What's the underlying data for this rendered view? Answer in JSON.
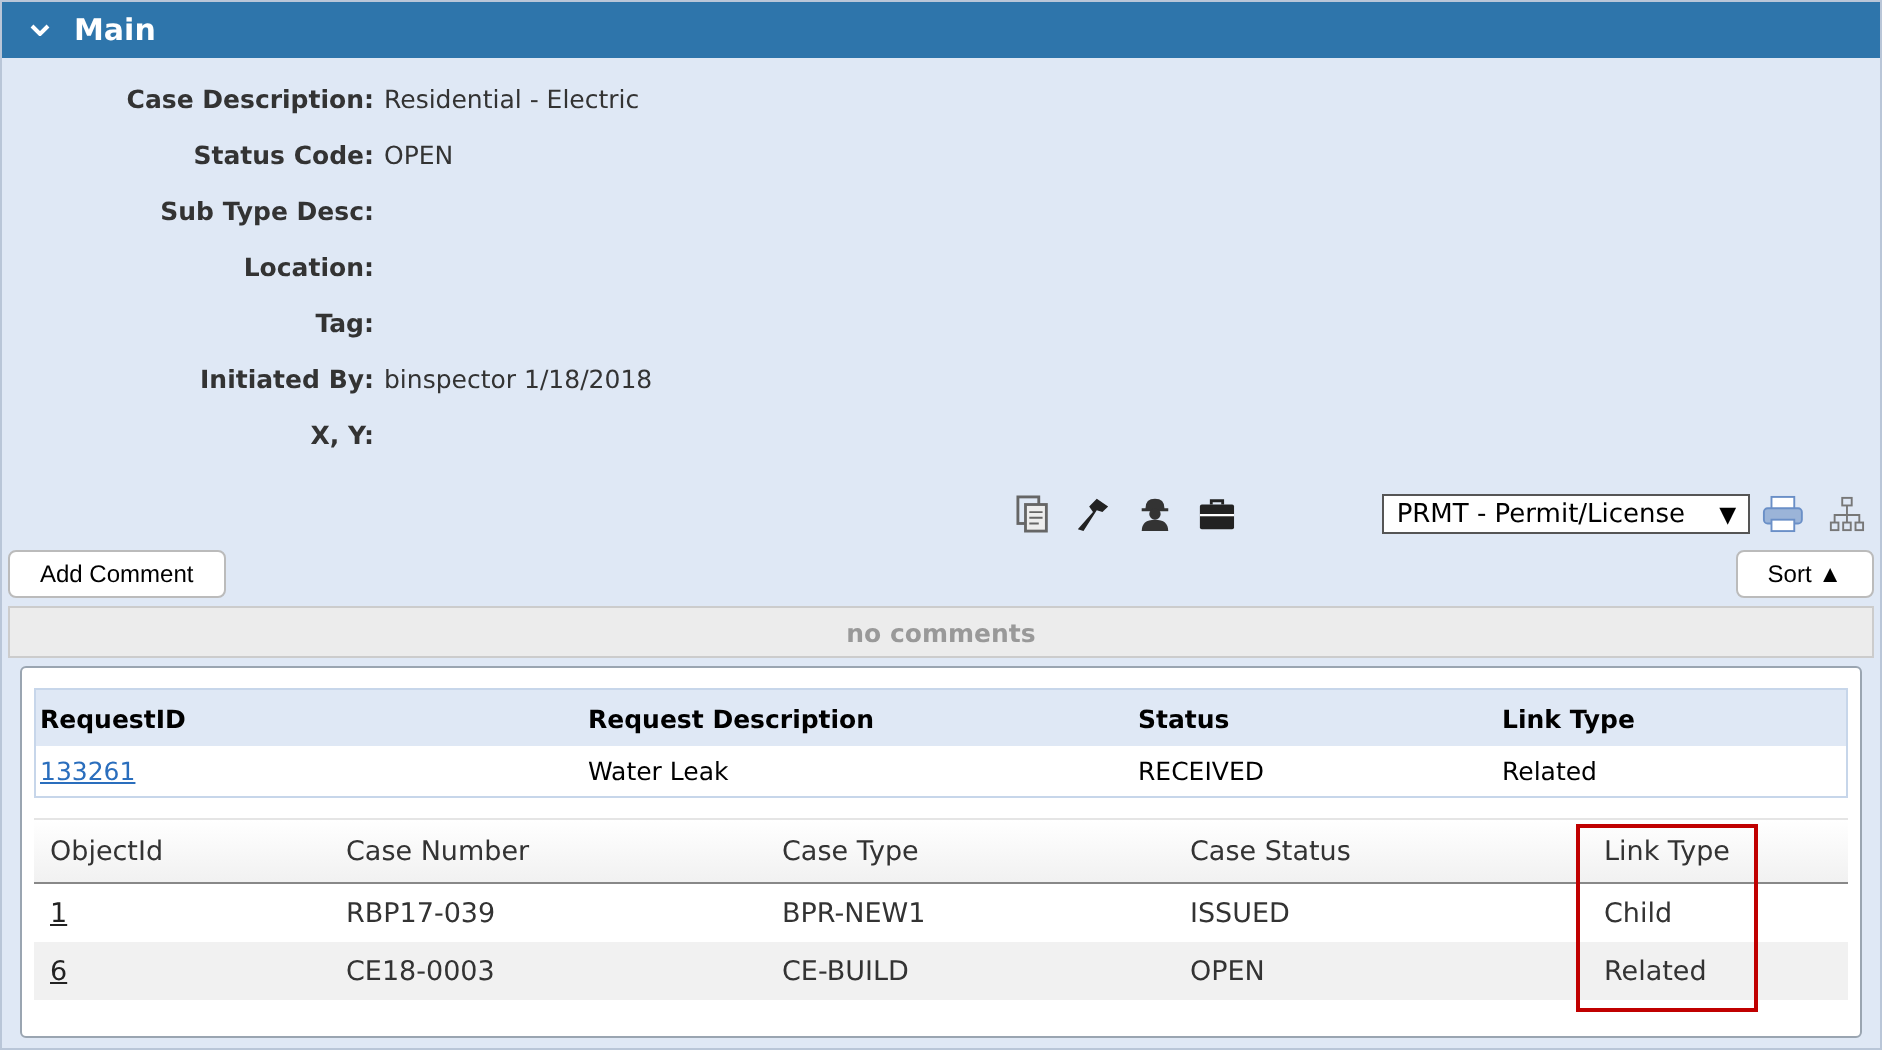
{
  "section": {
    "title": "Main",
    "expanded": true
  },
  "fields": [
    {
      "label": "Case Description:",
      "value": "Residential - Electric"
    },
    {
      "label": "Status Code:",
      "value": "OPEN"
    },
    {
      "label": "Sub Type Desc:"
    },
    {
      "label": "Location:"
    },
    {
      "label": "Tag:"
    },
    {
      "label": "Initiated By:",
      "value": "binspector 1/18/2018"
    },
    {
      "label": "X, Y:"
    }
  ],
  "module_select": {
    "value": "PRMT - Permit/License",
    "arrow": "▼"
  },
  "add_comment": "Add Comment",
  "sort": "Sort ▲",
  "comments_empty": "no comments",
  "requests": {
    "columns": [
      "RequestID",
      "Request Description",
      "Status",
      "Link Type"
    ],
    "rows": [
      {
        "request_id": "133261",
        "description": "Water Leak",
        "status": "RECEIVED",
        "link_type": "Related"
      }
    ]
  },
  "cases": {
    "columns": [
      {
        "label": "ObjectId",
        "highlighted": false
      },
      {
        "label": "Case Number",
        "highlighted": false
      },
      {
        "label": "Case Type",
        "highlighted": false
      },
      {
        "label": "Case Status",
        "highlighted": false
      },
      {
        "label": "Link Type",
        "highlighted": true
      }
    ],
    "rows": [
      {
        "cells": [
          "1",
          "RBP17-039",
          "BPR-NEW1",
          "ISSUED",
          "Child"
        ]
      },
      {
        "cells": [
          "6",
          "CE18-0003",
          "CE-BUILD",
          "OPEN",
          "Related"
        ]
      }
    ]
  }
}
